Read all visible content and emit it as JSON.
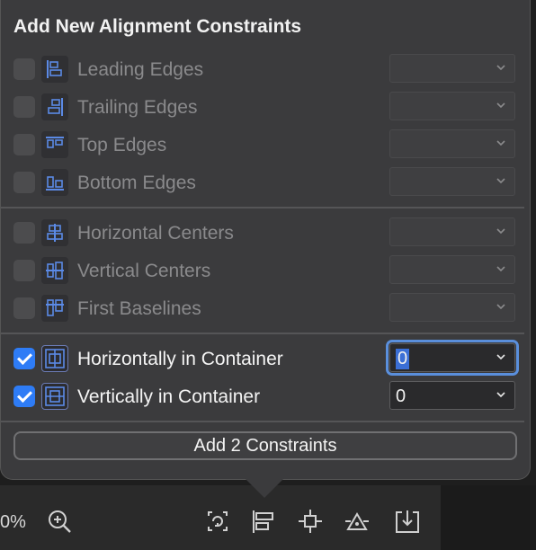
{
  "popover": {
    "title": "Add New Alignment Constraints",
    "group1": [
      {
        "label": "Leading Edges",
        "checked": false,
        "icon": "leading-edges-icon"
      },
      {
        "label": "Trailing Edges",
        "checked": false,
        "icon": "trailing-edges-icon"
      },
      {
        "label": "Top Edges",
        "checked": false,
        "icon": "top-edges-icon"
      },
      {
        "label": "Bottom Edges",
        "checked": false,
        "icon": "bottom-edges-icon"
      }
    ],
    "group2": [
      {
        "label": "Horizontal Centers",
        "checked": false,
        "icon": "horizontal-centers-icon"
      },
      {
        "label": "Vertical Centers",
        "checked": false,
        "icon": "vertical-centers-icon"
      },
      {
        "label": "First Baselines",
        "checked": false,
        "icon": "first-baselines-icon"
      }
    ],
    "group3": [
      {
        "label": "Horizontally in Container",
        "checked": true,
        "value": "0",
        "icon": "horizontally-in-container-icon"
      },
      {
        "label": "Vertically in Container",
        "checked": true,
        "value": "0",
        "icon": "vertically-in-container-icon"
      }
    ],
    "add_button": "Add 2 Constraints"
  },
  "toolbar": {
    "zoom_text": "0%",
    "icons": [
      "zoom-in-icon",
      "update-frames-icon",
      "align-icon",
      "add-constraints-icon",
      "resolve-issues-icon",
      "embed-in-icon"
    ]
  },
  "colors": {
    "popover_bg": "#3b3b3d",
    "accent": "#2e7cf6",
    "icon_blue": "#5b8ae6"
  }
}
